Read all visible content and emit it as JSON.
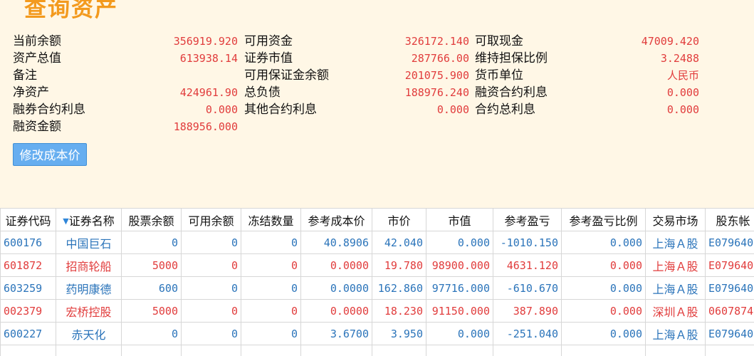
{
  "page": {
    "title": "查询资产",
    "button_label": "修改成本价"
  },
  "summary": {
    "rows": [
      [
        {
          "label": "当前余额",
          "value": "356919.920"
        },
        {
          "label": "可用资金",
          "value": "326172.140"
        },
        {
          "label": "可取现金",
          "value": "47009.420"
        }
      ],
      [
        {
          "label": "资产总值",
          "value": "613938.14"
        },
        {
          "label": "证券市值",
          "value": "287766.00"
        },
        {
          "label": "维持担保比例",
          "value": "3.2488"
        }
      ],
      [
        {
          "label": "备注",
          "value": ""
        },
        {
          "label": "可用保证金余额",
          "value": "201075.900"
        },
        {
          "label": "货币单位",
          "value": "人民币"
        }
      ],
      [
        {
          "label": "净资产",
          "value": "424961.90"
        },
        {
          "label": "总负债",
          "value": "188976.240"
        },
        {
          "label": "融资合约利息",
          "value": "0.000"
        }
      ],
      [
        {
          "label": "融券合约利息",
          "value": "0.000"
        },
        {
          "label": "其他合约利息",
          "value": "0.000"
        },
        {
          "label": "合约总利息",
          "value": "0.000"
        }
      ],
      [
        {
          "label": "融资金额",
          "value": "188956.000"
        },
        {
          "label": "",
          "value": ""
        },
        {
          "label": "",
          "value": ""
        }
      ]
    ]
  },
  "table": {
    "headers": [
      "证券代码",
      "证券名称",
      "股票余额",
      "可用余额",
      "冻结数量",
      "参考成本价",
      "市价",
      "市值",
      "参考盈亏",
      "参考盈亏比例",
      "交易市场",
      "股东帐"
    ],
    "sort_icon": "▼",
    "rows": [
      {
        "status": "down",
        "code": "600176",
        "name": "中国巨石",
        "stock_balance": "0",
        "available_balance": "0",
        "frozen_qty": "0",
        "ref_cost": "40.8906",
        "price": "42.040",
        "market_value": "0.000",
        "ref_pl": "-1010.150",
        "ref_pl_ratio": "0.000",
        "market": "上海Ａ股",
        "account": "E079640"
      },
      {
        "status": "up",
        "code": "601872",
        "name": "招商轮船",
        "stock_balance": "5000",
        "available_balance": "0",
        "frozen_qty": "0",
        "ref_cost": "0.0000",
        "price": "19.780",
        "market_value": "98900.000",
        "ref_pl": "4631.120",
        "ref_pl_ratio": "0.000",
        "market": "上海Ａ股",
        "account": "E079640"
      },
      {
        "status": "down",
        "code": "603259",
        "name": "药明康德",
        "stock_balance": "600",
        "available_balance": "0",
        "frozen_qty": "0",
        "ref_cost": "0.0000",
        "price": "162.860",
        "market_value": "97716.000",
        "ref_pl": "-610.670",
        "ref_pl_ratio": "0.000",
        "market": "上海Ａ股",
        "account": "E079640"
      },
      {
        "status": "up",
        "code": "002379",
        "name": "宏桥控股",
        "stock_balance": "5000",
        "available_balance": "0",
        "frozen_qty": "0",
        "ref_cost": "0.0000",
        "price": "18.230",
        "market_value": "91150.000",
        "ref_pl": "387.890",
        "ref_pl_ratio": "0.000",
        "market": "深圳Ａ股",
        "account": "0607874"
      },
      {
        "status": "down",
        "code": "600227",
        "name": "赤天化",
        "stock_balance": "0",
        "available_balance": "0",
        "frozen_qty": "0",
        "ref_cost": "3.6700",
        "price": "3.950",
        "market_value": "0.000",
        "ref_pl": "-251.040",
        "ref_pl_ratio": "0.000",
        "market": "上海Ａ股",
        "account": "E079640"
      },
      {
        "status": "down",
        "code": "",
        "name": "",
        "stock_balance": "",
        "available_balance": "",
        "frozen_qty": "",
        "ref_cost": "",
        "price": "",
        "market_value": "",
        "ref_pl": "",
        "ref_pl_ratio": "",
        "market": "",
        "account": ""
      }
    ]
  },
  "colors": {
    "background": "#fff7e6",
    "title": "#f39a1e",
    "value_red": "#e13c3c",
    "value_blue": "#2b74ba",
    "button": "#66aef0"
  }
}
